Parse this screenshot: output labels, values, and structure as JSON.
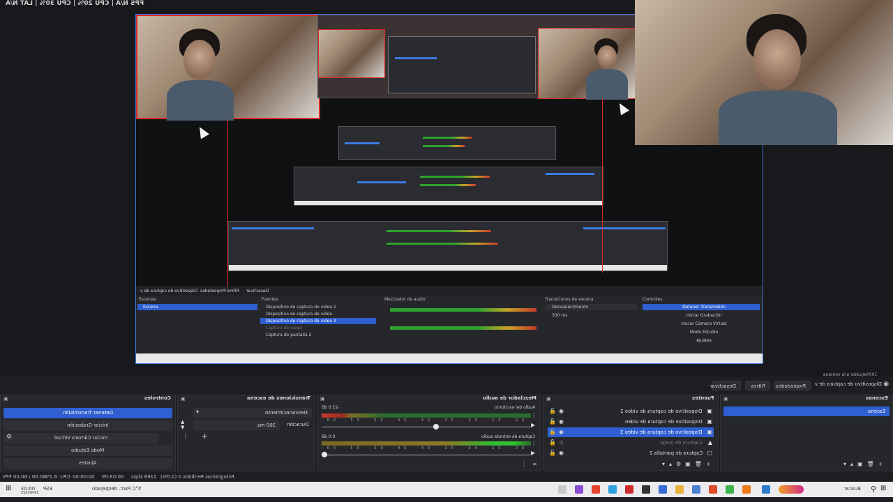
{
  "preview": {
    "stats": "FPS N/A | CPU 20% | CPU 30% | LAT N/A",
    "mini_labels": {
      "scenes": "Escenas",
      "sources": "Fuentes",
      "mixer": "Mezclador de audio",
      "transitions": "Transiciones de escena",
      "controls": "Controles",
      "source_sel": "Dispositivo de captura de video 3",
      "transition_name": "Desvanecimiento",
      "duration": "300 ms",
      "stop_stream": "Detener Transmisión",
      "start_rec": "Iniciar Grabación",
      "start_vcam": "Iniciar Cámara Virtual",
      "studio": "Modo Estudio",
      "settings": "Ajustes",
      "scene": "Escena",
      "src1": "Dispositivo de captura de video 2",
      "src2": "Dispositivo de captura de video",
      "src3": "Dispositivo de captura de video 3",
      "src4": "Captura de juego",
      "src5": "Captura de pantalla 2",
      "props_bar_name": "Dispositivo de captura de v",
      "props_btn": "Propiedades",
      "filters_btn": "Filtros",
      "deactivate_btn": "Desactivar"
    }
  },
  "toolbar": {
    "current_source": "Dispositivo de captura de v",
    "properties": "Propiedades",
    "filters": "Filtros",
    "deactivate": "Desactivar",
    "fit": "Ajustar a la ventana",
    "zoom": "100%"
  },
  "scenes": {
    "title": "Escenas",
    "items": [
      "Escena"
    ]
  },
  "sources": {
    "title": "Fuentes",
    "items": [
      {
        "name": "Dispositivo de captura de video 2",
        "selected": false,
        "visible": true
      },
      {
        "name": "Dispositivo de captura de video",
        "selected": false,
        "visible": true
      },
      {
        "name": "Dispositivo de captura de video 3",
        "selected": true,
        "visible": true
      },
      {
        "name": "Captura de juego",
        "selected": false,
        "visible": false
      },
      {
        "name": "Captura de pantalla 2",
        "selected": false,
        "visible": true
      }
    ]
  },
  "mixer": {
    "title": "Mezclador de audio",
    "channels": [
      {
        "name": "Audio del escritorio",
        "db": "-22.0 dB"
      },
      {
        "name": "Captura de entrada audio",
        "db": "0.0 dB"
      }
    ],
    "scale": "-60 -55 -50 -45 -40 -35 -30 -25 -20 -15 -10 -5 0"
  },
  "transitions": {
    "title": "Transiciones de escena",
    "type": "Desvanecimiento",
    "duration_label": "Duración",
    "duration_value": "300 ms"
  },
  "controls": {
    "title": "Controles",
    "stop_stream": "Detener Transmisión",
    "start_recording": "Iniciar Grabación",
    "start_virtual_cam": "Iniciar Cámara Virtual",
    "studio_mode": "Modo Estudio",
    "settings": "Ajustes"
  },
  "status": {
    "dropped": "Fotogramas Perdidos 0 (0.0%)",
    "bitrate": "2269 kbps",
    "live": "00:03:09",
    "rec": "00:00:00",
    "cpu": "CPU: 6.2%",
    "fps": "60.00 / 60.00 FPS"
  },
  "taskbar": {
    "search": "Buscar",
    "weather": "5°C Parc. despejado",
    "time": "00:03",
    "date": "28/4/2025",
    "lang": "ESP"
  },
  "colors": {
    "accent": "#2f5fd0",
    "rec_border": "#d92a2a",
    "preview_border": "#3a78d8"
  }
}
